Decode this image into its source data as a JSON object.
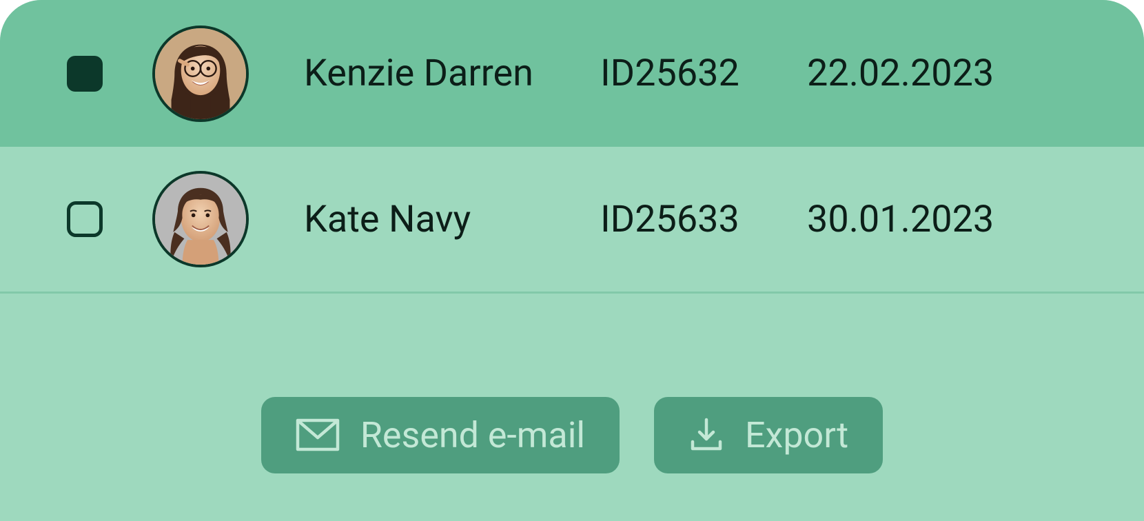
{
  "rows": [
    {
      "name": "Kenzie Darren",
      "id": "ID25632",
      "date": "22.02.2023",
      "selected": true
    },
    {
      "name": "Kate Navy",
      "id": "ID25633",
      "date": "30.01.2023",
      "selected": false
    }
  ],
  "actions": {
    "resend_label": "Resend e-mail",
    "export_label": "Export"
  },
  "colors": {
    "bg_light": "#9ed9be",
    "bg_selected": "#70c29e",
    "btn_bg": "#4f9e7f",
    "btn_text": "#c3e8d6",
    "text": "#0c1e18",
    "dark": "#0c382a"
  }
}
